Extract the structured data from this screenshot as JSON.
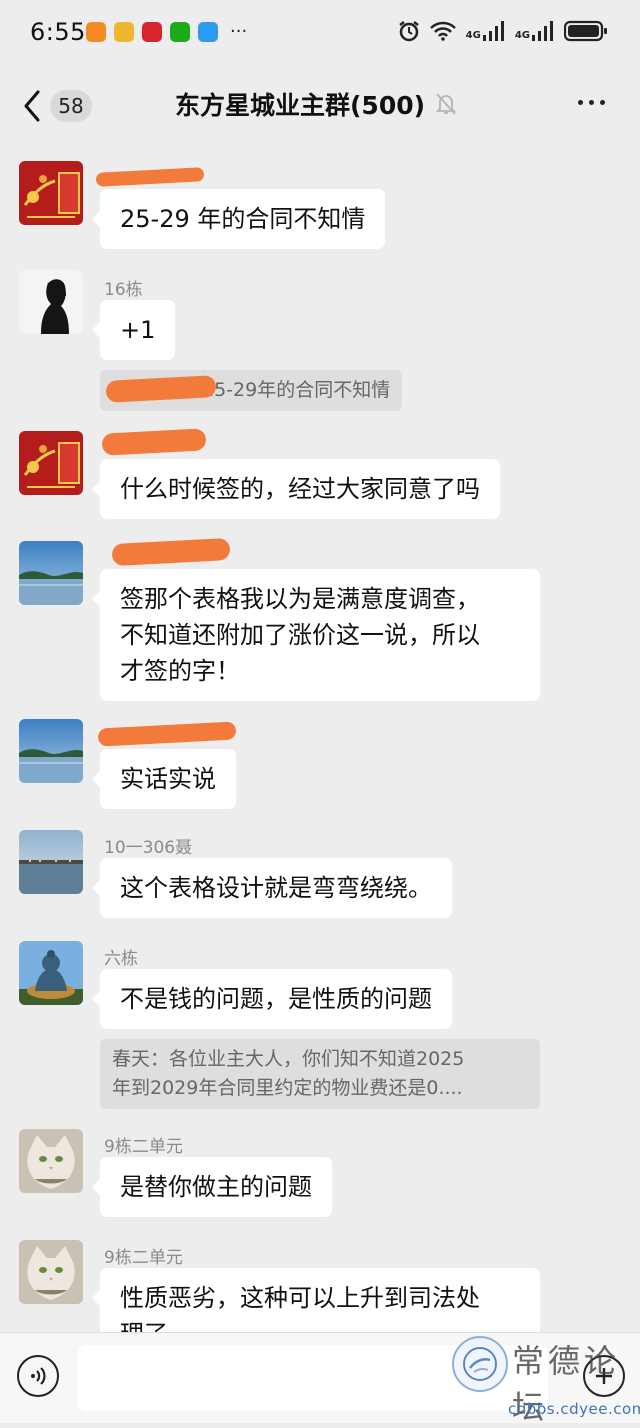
{
  "status_bar": {
    "time": "6:55",
    "more": "···",
    "network_1": "4G",
    "network_2": "4G",
    "app_icon_colors": [
      "#f08a24",
      "#f0b62d",
      "#d9262c",
      "#1aad19",
      "#2b9cf0"
    ]
  },
  "nav": {
    "back_icon": "chevron-left-icon",
    "unread_count": "58",
    "title": "东方星城业主群(500)",
    "mute_icon": "bell-off-icon",
    "more_icon": "more-dots-icon"
  },
  "messages": [
    {
      "sender": "",
      "sender_redacted": true,
      "text": "25-29 年的合同不知情",
      "avatar": "red-card-avatar"
    },
    {
      "sender": "16栋",
      "text": "+1",
      "avatar": "silhouette-avatar",
      "quote": {
        "visible_text": "25-29年的合同不知情",
        "sender_redacted": true
      }
    },
    {
      "sender": "",
      "sender_redacted": true,
      "text": "什么时候签的，经过大家同意了吗",
      "avatar": "red-card-avatar"
    },
    {
      "sender": "",
      "sender_redacted": true,
      "text_lines": [
        "签那个表格我以为是满意度调查，",
        "不知道还附加了涨价这一说，所以",
        "才签的字！"
      ],
      "avatar": "lake-avatar"
    },
    {
      "sender": "",
      "sender_redacted": true,
      "text": "实话实说",
      "avatar": "lake-avatar"
    },
    {
      "sender": "10一306聂",
      "text": "这个表格设计就是弯弯绕绕。",
      "avatar": "dusk-lake-avatar"
    },
    {
      "sender": "六栋",
      "text": "不是钱的问题，是性质的问题",
      "avatar": "buddha-avatar",
      "quote": {
        "lines": [
          "春天：各位业主大人，你们知不知道2025",
          "年到2029年合同里约定的物业费还是0...."
        ]
      }
    },
    {
      "sender": "9栋二单元",
      "text": "是替你做主的问题",
      "avatar": "cat-avatar"
    },
    {
      "sender": "9栋二单元",
      "text_lines": [
        "性质恶劣，这种可以上升到司法处",
        "理了"
      ],
      "avatar": "cat-avatar"
    }
  ],
  "input_bar": {
    "voice_icon": "voice-icon",
    "input_value": "",
    "plus_icon": "plus-icon"
  },
  "watermark": {
    "text": "常德论坛",
    "url": "cdbbs.cdyee.com"
  },
  "colors": {
    "background": "#ededed",
    "bubble": "#ffffff",
    "quote": "#dedede",
    "redaction": "#f27a3a"
  }
}
